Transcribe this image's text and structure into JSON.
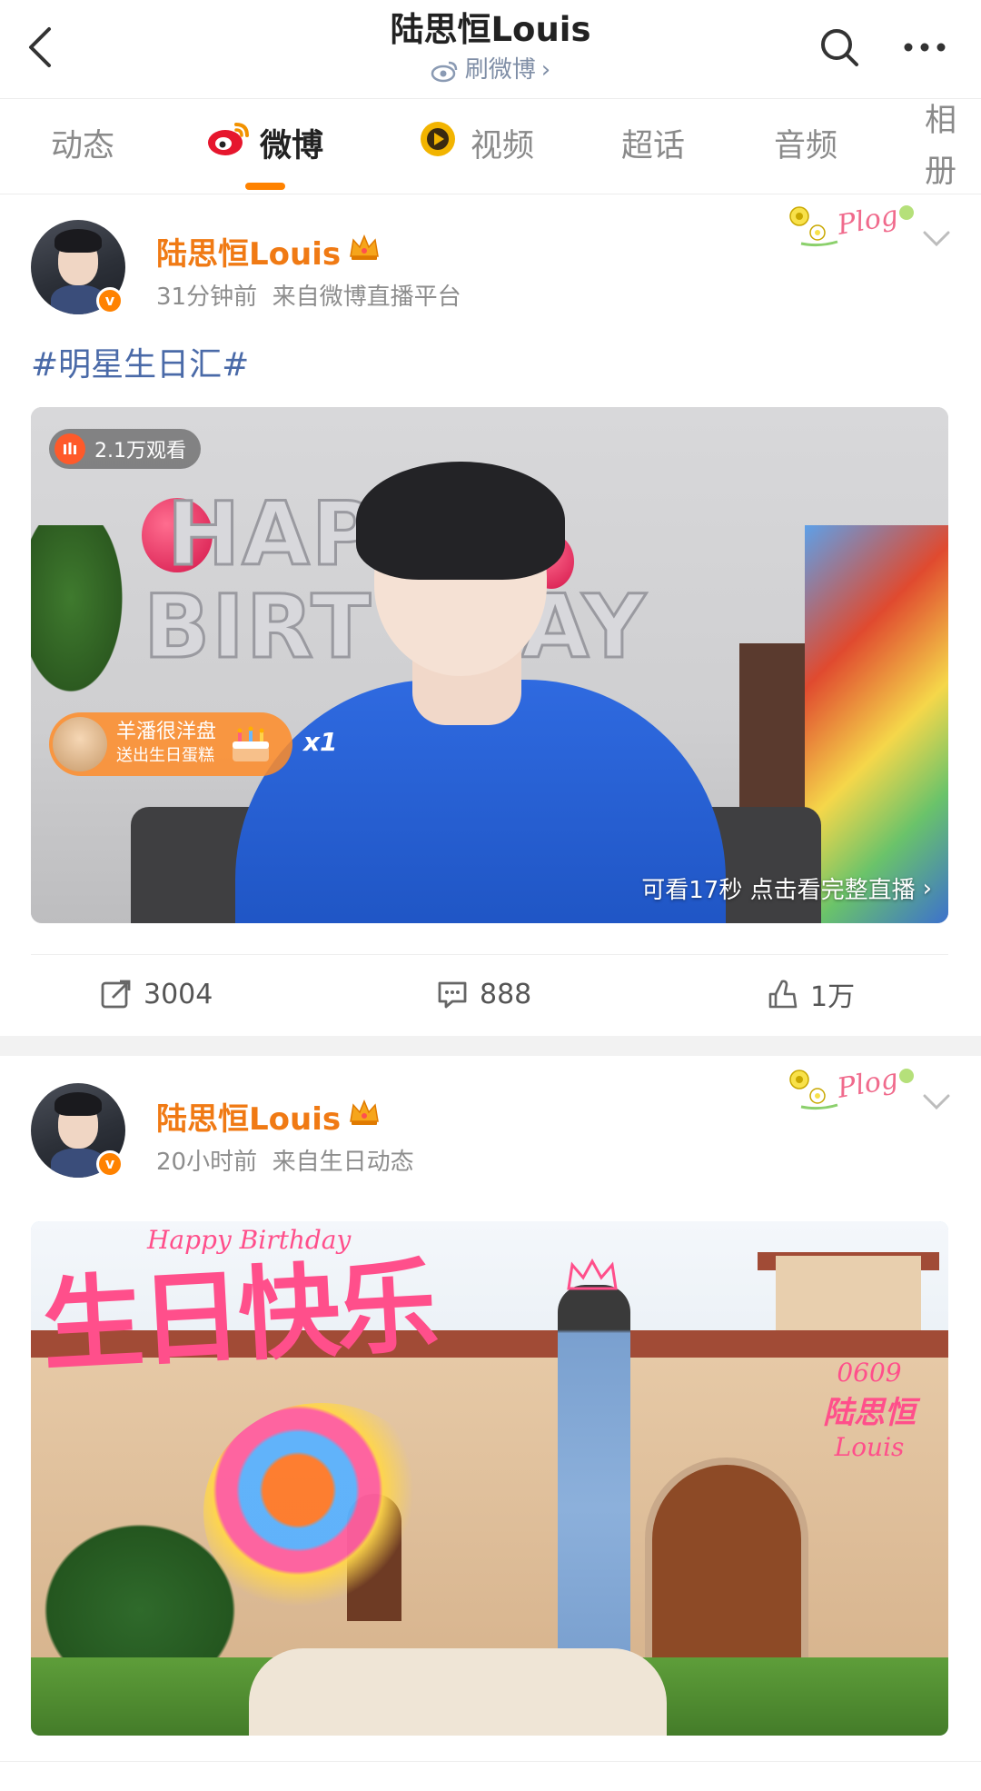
{
  "header": {
    "title": "陆思恒Louis",
    "subtitle": "刷微博"
  },
  "tabs": [
    {
      "label": "动态"
    },
    {
      "label": "微博"
    },
    {
      "label": "视频"
    },
    {
      "label": "超话"
    },
    {
      "label": "音频"
    },
    {
      "label": "相册"
    }
  ],
  "post1": {
    "author": "陆思恒Louis",
    "time": "31分钟前",
    "source": "来自微博直播平台",
    "hashtag": "#明星生日汇#",
    "video": {
      "views": "2.1万观看",
      "gift_user": "羊潘很洋盘",
      "gift_desc": "送出生日蛋糕",
      "gift_count": "x1",
      "cta": "可看17秒 点击看完整直播",
      "foil_line1": "HAP",
      "foil_line2": "BIRT",
      "foil_line3": "AY"
    },
    "actions": {
      "repost": "3004",
      "comment": "888",
      "like": "1万"
    },
    "verified_mark": "v"
  },
  "post2": {
    "author": "陆思恒Louis",
    "time": "20小时前",
    "source": "来自生日动态",
    "verified_mark": "v",
    "poster": {
      "title_en": "Happy Birthday",
      "title_cn": "生日快乐",
      "sig_date": "0609",
      "sig_name": "陆思恒",
      "sig_en": "Louis"
    }
  },
  "decor": {
    "plog": "Plog"
  },
  "colors": {
    "accent": "#ff8200",
    "username": "#f07a14",
    "link": "#4a6aa8"
  }
}
